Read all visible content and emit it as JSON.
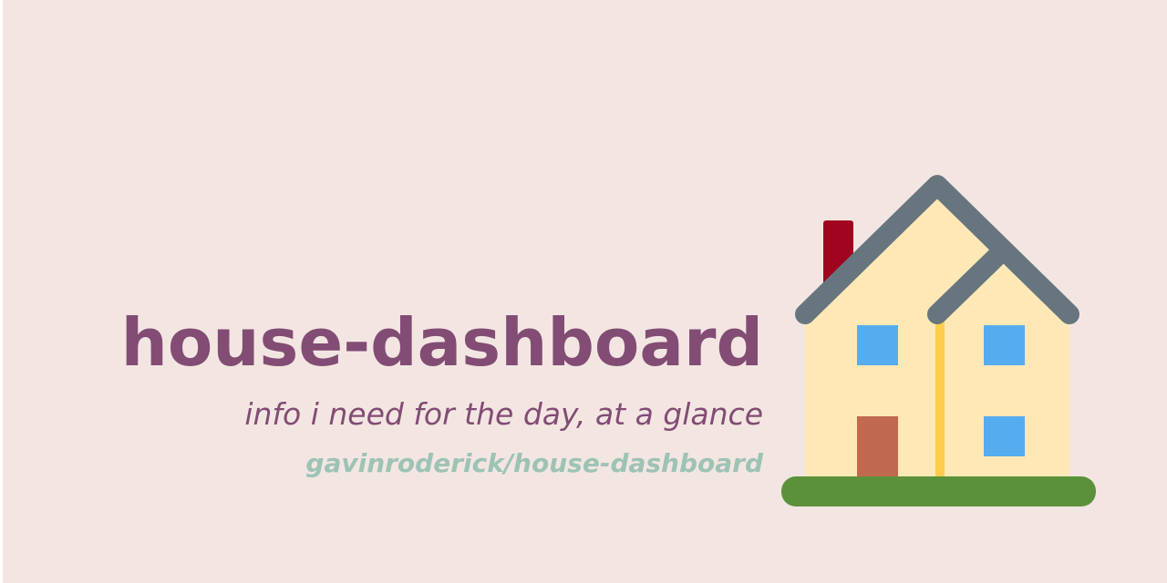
{
  "header": {
    "title": "house-dashboard",
    "subtitle": "info i need for the day, at a glance",
    "repo": "gavinroderick/house-dashboard"
  },
  "illustration": {
    "icon": "house-icon"
  },
  "colors": {
    "background": "#f3e6e2",
    "title": "#824c74",
    "repo": "#9dc3b5",
    "roof": "#67757f",
    "wall": "#ffe8b6",
    "chimney": "#a0041e",
    "window": "#55acee",
    "door": "#c1694f",
    "grass": "#5c913b",
    "trim": "#ffcc4d"
  }
}
